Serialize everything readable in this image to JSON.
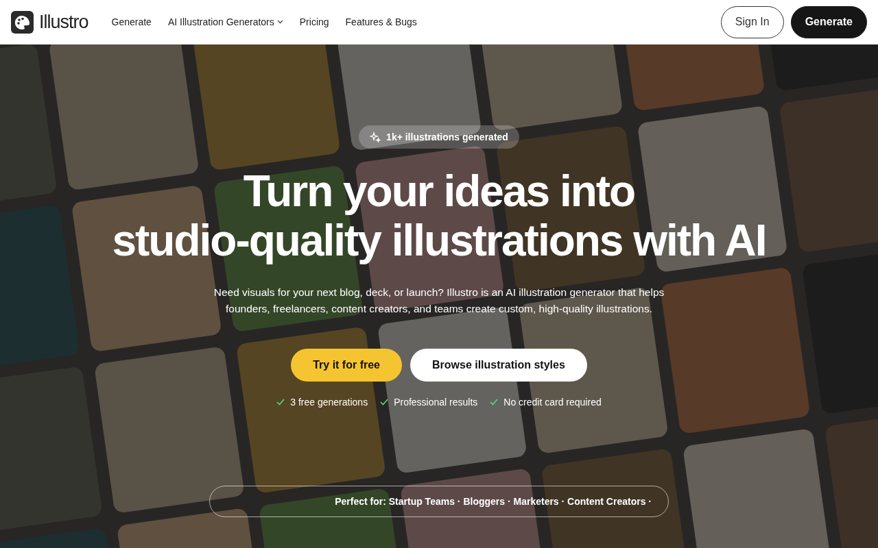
{
  "header": {
    "logo": "Illustro",
    "nav": [
      {
        "label": "Generate",
        "dropdown": false
      },
      {
        "label": "AI Illustration Generators",
        "dropdown": true
      },
      {
        "label": "Pricing",
        "dropdown": false
      },
      {
        "label": "Features & Bugs",
        "dropdown": false
      }
    ],
    "buttons": [
      {
        "label": "Sign In",
        "kind": "outline"
      },
      {
        "label": "Generate",
        "kind": "solid"
      }
    ]
  },
  "hero": {
    "badge": "1k+ illustrations generated",
    "title_lines": [
      "Turn your ideas into",
      "studio-quality illustrations with AI"
    ],
    "description": "Need visuals for your next blog, deck, or launch? Illustro is an AI illustration generator that helps founders, freelancers, content creators, and teams create custom, high-quality illustrations.",
    "buttons": [
      {
        "label": "Try it for free",
        "kind": "primary"
      },
      {
        "label": "Browse illustration styles",
        "kind": "secondary"
      }
    ],
    "features": [
      "3 free generations",
      "Professional results",
      "No credit card required"
    ],
    "audience": "Perfect for: Startup Teams · Bloggers · Marketers · Content Creators ·"
  }
}
